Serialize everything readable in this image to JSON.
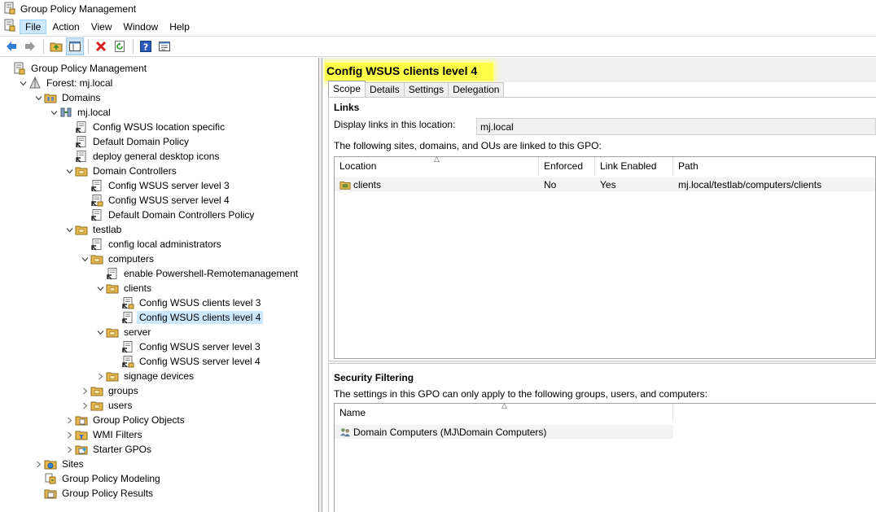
{
  "window": {
    "title": "Group Policy Management"
  },
  "menu": [
    "File",
    "Action",
    "Window",
    "Help"
  ],
  "toolbar": {
    "buttons": [
      "back-arrow-icon",
      "forward-arrow-icon",
      "folder-up-icon",
      "show-hide-console-tree-icon",
      "delete-icon",
      "refresh-icon",
      "help-icon",
      "properties-icon"
    ]
  },
  "tree": [
    {
      "label": "Group Policy Management",
      "level": 0,
      "exp": "",
      "icon": "gpm-icon"
    },
    {
      "label": "Forest: mj.local",
      "level": 1,
      "exp": "open",
      "icon": "forest-icon"
    },
    {
      "label": "Domains",
      "level": 2,
      "exp": "open",
      "icon": "domains-icon"
    },
    {
      "label": "mj.local",
      "level": 3,
      "exp": "open",
      "icon": "domain-icon"
    },
    {
      "label": "Config WSUS location specific",
      "level": 4,
      "exp": "",
      "icon": "gpo-link-icon"
    },
    {
      "label": "Default Domain Policy",
      "level": 4,
      "exp": "",
      "icon": "gpo-link-icon"
    },
    {
      "label": "deploy general desktop icons",
      "level": 4,
      "exp": "",
      "icon": "gpo-link-icon"
    },
    {
      "label": "Domain Controllers",
      "level": 4,
      "exp": "open",
      "icon": "ou-icon"
    },
    {
      "label": "Config WSUS server level 3",
      "level": 5,
      "exp": "",
      "icon": "gpo-link-icon"
    },
    {
      "label": "Config WSUS server level 4",
      "level": 5,
      "exp": "",
      "icon": "gpo-link-locked-icon"
    },
    {
      "label": "Default Domain Controllers Policy",
      "level": 5,
      "exp": "",
      "icon": "gpo-link-icon"
    },
    {
      "label": "testlab",
      "level": 4,
      "exp": "open",
      "icon": "ou-icon"
    },
    {
      "label": "config local administrators",
      "level": 5,
      "exp": "",
      "icon": "gpo-link-icon"
    },
    {
      "label": "computers",
      "level": 5,
      "exp": "open",
      "icon": "ou-icon"
    },
    {
      "label": "enable Powershell-Remotemanagement",
      "level": 6,
      "exp": "",
      "icon": "gpo-link-icon"
    },
    {
      "label": "clients",
      "level": 6,
      "exp": "open",
      "icon": "ou-icon"
    },
    {
      "label": "Config WSUS clients level 3",
      "level": 7,
      "exp": "",
      "icon": "gpo-link-locked-icon"
    },
    {
      "label": "Config WSUS clients level 4",
      "level": 7,
      "exp": "",
      "icon": "gpo-link-icon",
      "selected": true
    },
    {
      "label": "server",
      "level": 6,
      "exp": "open",
      "icon": "ou-icon"
    },
    {
      "label": "Config WSUS server level 3",
      "level": 7,
      "exp": "",
      "icon": "gpo-link-icon"
    },
    {
      "label": "Config WSUS server level 4",
      "level": 7,
      "exp": "",
      "icon": "gpo-link-locked-icon"
    },
    {
      "label": "signage devices",
      "level": 6,
      "exp": "closed",
      "icon": "ou-icon"
    },
    {
      "label": "groups",
      "level": 5,
      "exp": "closed",
      "icon": "ou-icon"
    },
    {
      "label": "users",
      "level": 5,
      "exp": "closed",
      "icon": "ou-icon"
    },
    {
      "label": "Group Policy Objects",
      "level": 4,
      "exp": "closed",
      "icon": "gpo-folder-icon"
    },
    {
      "label": "WMI Filters",
      "level": 4,
      "exp": "closed",
      "icon": "wmi-folder-icon"
    },
    {
      "label": "Starter GPOs",
      "level": 4,
      "exp": "closed",
      "icon": "starter-gpo-folder-icon"
    },
    {
      "label": "Sites",
      "level": 2,
      "exp": "closed",
      "icon": "sites-icon"
    },
    {
      "label": "Group Policy Modeling",
      "level": 2,
      "exp": "",
      "icon": "modeling-icon"
    },
    {
      "label": "Group Policy Results",
      "level": 2,
      "exp": "",
      "icon": "results-icon"
    }
  ],
  "details": {
    "title": "Config WSUS clients level 4",
    "tabs": [
      "Scope",
      "Details",
      "Settings",
      "Delegation"
    ],
    "links": {
      "heading": "Links",
      "display_label": "Display links in this location:",
      "display_value": "mj.local",
      "description": "The following sites, domains, and OUs are linked to this GPO:",
      "columns": [
        "Location",
        "Enforced",
        "Link Enabled",
        "Path"
      ],
      "rows": [
        {
          "location": "clients",
          "enforced": "No",
          "link_enabled": "Yes",
          "path": "mj.local/testlab/computers/clients"
        }
      ]
    },
    "security": {
      "heading": "Security Filtering",
      "description": "The settings in this GPO can only apply to the following groups, users, and computers:",
      "columns": [
        "Name"
      ],
      "rows": [
        {
          "name": "Domain Computers (MJ\\Domain Computers)"
        }
      ]
    }
  },
  "colors": {
    "highlight": "#ffff4a",
    "selection": "#cce8ff",
    "folder": "#e8b84a"
  }
}
